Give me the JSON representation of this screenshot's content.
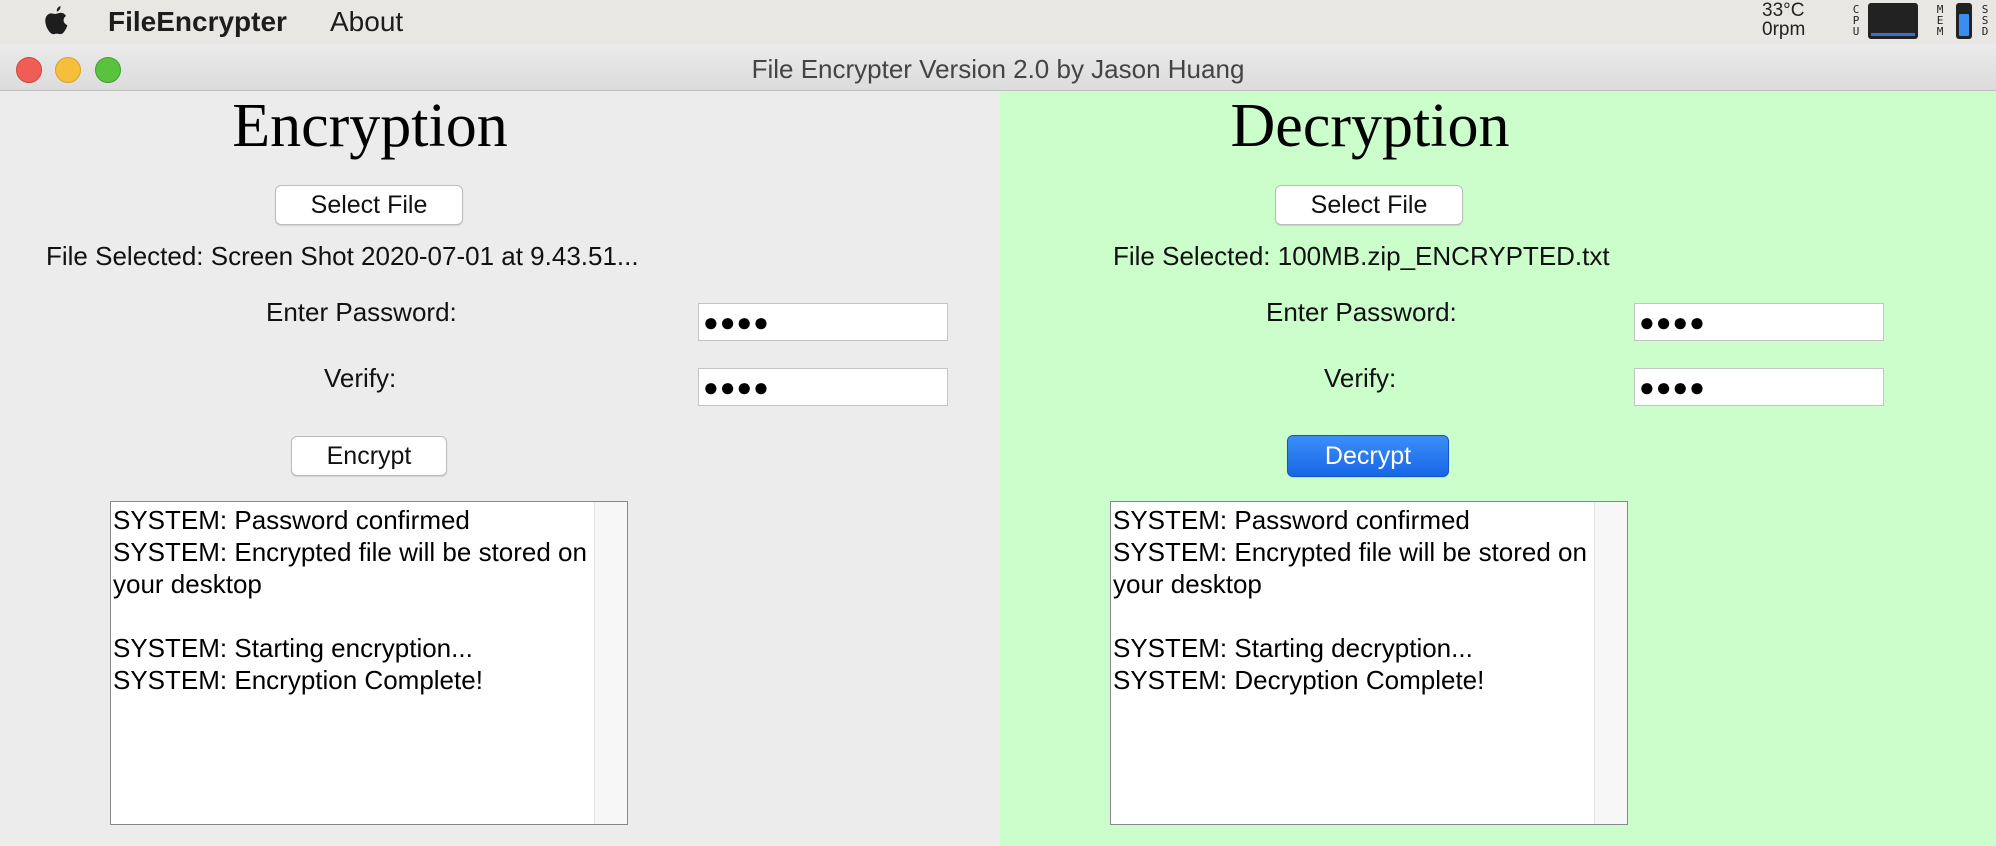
{
  "menubar": {
    "app_name": "FileEncrypter",
    "about": "About",
    "temperature": "33°C",
    "fan": "0rpm",
    "cpu_label": "CPU",
    "mem_label": "MEM",
    "ssd_label": "SSD"
  },
  "window": {
    "title": "File Encrypter Version 2.0 by Jason Huang"
  },
  "encryption": {
    "heading": "Encryption",
    "select_file_label": "Select File",
    "file_selected": "File Selected: Screen Shot 2020-07-01 at 9.43.51...",
    "password_label": "Enter Password:",
    "password_value": "●●●●",
    "verify_label": "Verify:",
    "verify_value": "●●●●",
    "action_label": "Encrypt",
    "log": "SYSTEM: Password confirmed\nSYSTEM: Encrypted file will be stored on your desktop\n\nSYSTEM: Starting encryption...\nSYSTEM: Encryption Complete!"
  },
  "decryption": {
    "heading": "Decryption",
    "select_file_label": "Select File",
    "file_selected": "File Selected: 100MB.zip_ENCRYPTED.txt",
    "password_label": "Enter Password:",
    "password_value": "●●●●",
    "verify_label": "Verify:",
    "verify_value": "●●●●",
    "action_label": "Decrypt",
    "log": "SYSTEM: Password confirmed\nSYSTEM: Encrypted file will be stored on your desktop\n\nSYSTEM: Starting decryption...\nSYSTEM: Decryption Complete!"
  },
  "colors": {
    "left_panel": "#ececec",
    "right_panel": "#ccfecb",
    "primary_button": "#1f6fec"
  }
}
